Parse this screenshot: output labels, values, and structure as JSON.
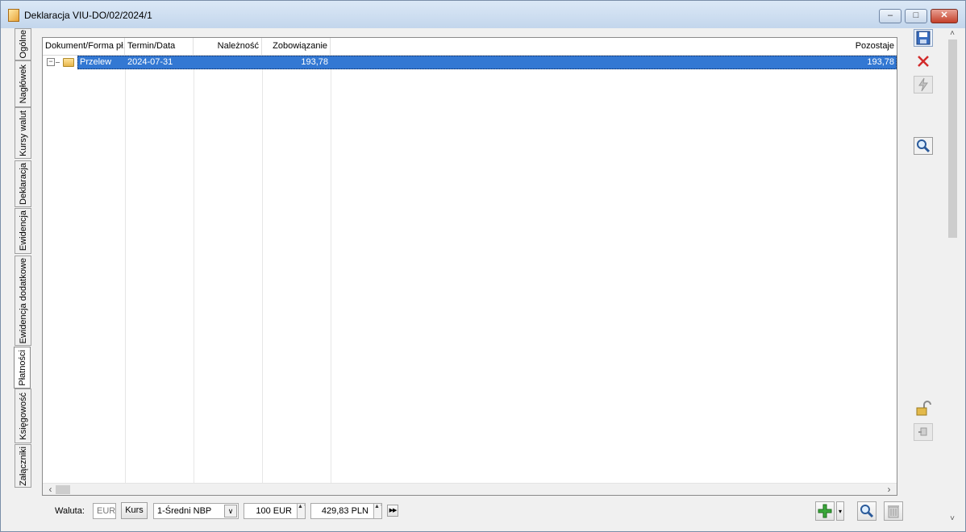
{
  "window": {
    "title": "Deklaracja VIU-DO/02/2024/1",
    "minimize_glyph": "‒",
    "maximize_glyph": "□",
    "close_glyph": "✕"
  },
  "tabs": [
    {
      "label": "Ogólne",
      "active": false
    },
    {
      "label": "Nagłówek",
      "active": false
    },
    {
      "label": "Kursy walut",
      "active": false
    },
    {
      "label": "Deklaracja",
      "active": false
    },
    {
      "label": "Ewidencja",
      "active": false
    },
    {
      "label": "Ewidencja dodatkowe",
      "active": false
    },
    {
      "label": "Płatności",
      "active": true
    },
    {
      "label": "Księgowość",
      "active": false
    },
    {
      "label": "Załączniki",
      "active": false
    }
  ],
  "grid": {
    "columns": [
      "Dokument/Forma pł.",
      "Termin/Data",
      "Należność",
      "Zobowiązanie",
      "Pozostaje"
    ],
    "rows": [
      {
        "expander": "−",
        "forma": "Przelew",
        "termin": "2024-07-31",
        "naleznosc": "",
        "zobowiazanie": "193,78",
        "pozostaje": "193,78",
        "selected": true
      }
    ],
    "scroll_left": "‹",
    "scroll_right": "›"
  },
  "bottom_bar": {
    "waluta_label": "Waluta:",
    "waluta_value": "EUR",
    "kurs_button": "Kurs",
    "kurs_type": "1-Średni NBP",
    "dropdown_arrow": "∨",
    "amount_eur": "100 EUR",
    "amount_pln": "429,83 PLN",
    "spin_glyph": "▲▼",
    "next_glyph": "▶▶"
  },
  "right_toolbar": {
    "icons": [
      "save-icon",
      "cancel-icon",
      "lightning-icon",
      "preview-icon",
      "lock-icon",
      "pin-icon"
    ]
  },
  "vscroll": {
    "up": "˄",
    "down": "˅"
  },
  "colors": {
    "selection": "#3378d3",
    "add_green": "#3aa83a",
    "cancel_red": "#d22a2a"
  }
}
